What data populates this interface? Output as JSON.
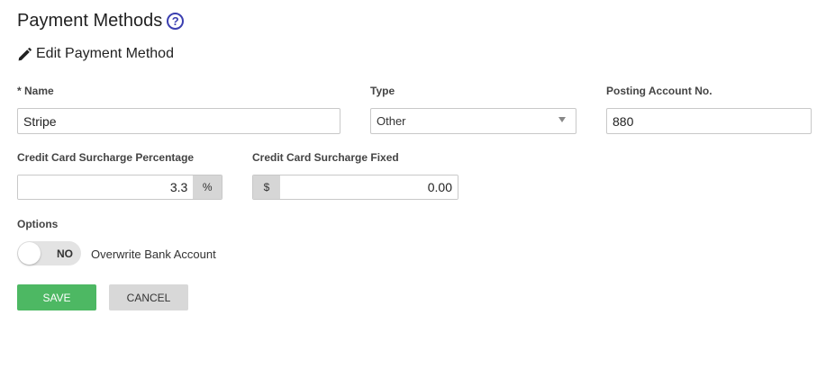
{
  "page": {
    "title": "Payment Methods",
    "help_icon": "?"
  },
  "section": {
    "title": "Edit Payment Method",
    "icon": "pencil-icon"
  },
  "form": {
    "name": {
      "label": "* Name",
      "value": "Stripe"
    },
    "type": {
      "label": "Type",
      "value": "Other"
    },
    "posting_account": {
      "label": "Posting Account No.",
      "value": "880"
    },
    "surcharge_percentage": {
      "label": "Credit Card Surcharge Percentage",
      "value": "3.3",
      "suffix": "%"
    },
    "surcharge_fixed": {
      "label": "Credit Card Surcharge Fixed",
      "value": "0.00",
      "prefix": "$"
    },
    "options": {
      "label": "Options",
      "overwrite_bank_account": {
        "toggle_text": "NO",
        "label": "Overwrite Bank Account",
        "checked": false
      }
    }
  },
  "buttons": {
    "save": "SAVE",
    "cancel": "CANCEL"
  },
  "colors": {
    "save_button": "#4db863",
    "cancel_button": "#d8d8d8",
    "help_icon": "#3b3fb0"
  }
}
